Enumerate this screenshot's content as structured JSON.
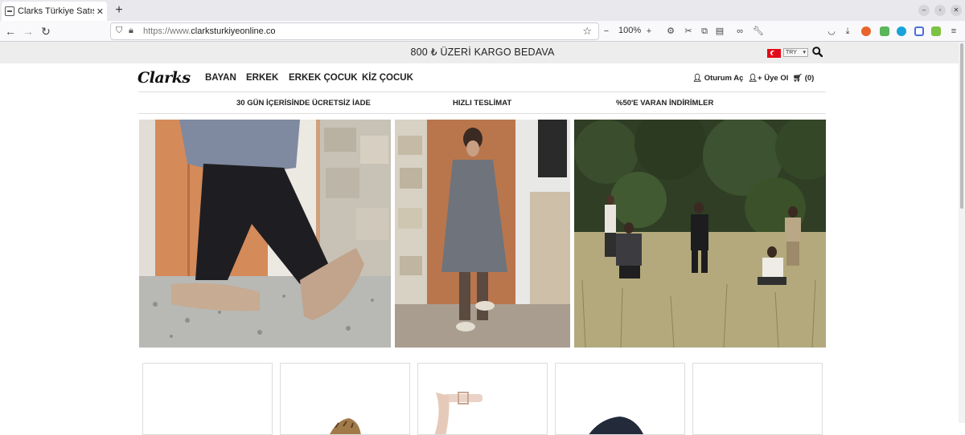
{
  "browser": {
    "tab_title": "Clarks Türkiye Satış Mağ",
    "new_tab_symbol": "+",
    "url_prefix": "https://www.",
    "url_domain": "clarksturkiyeonline.co",
    "zoom_level": "100%"
  },
  "site": {
    "announcement": "800 ₺ ÜZERİ KARGO BEDAVA",
    "currency_selected": "TRY",
    "logo_text": "Clarks",
    "nav": [
      "BAYAN",
      "ERKEK",
      "ERKEK ÇOCUK",
      "KİZ ÇOCUK"
    ],
    "account": {
      "login": "Oturum Aç",
      "register": "Üye Ol",
      "cart": "(0)"
    },
    "perks": [
      "30 GÜN İÇERİSİNDE ÜCRETSİZ İADE",
      "HIZLI TESLİMAT",
      "%50'E VARAN İNDİRİMLER"
    ],
    "colors": {
      "announce_bg": "#ededed",
      "flag_red": "#e30a17"
    }
  },
  "icons": {
    "search": "magnifier-icon",
    "user": "user-icon",
    "add_user": "user-plus-icon",
    "cart": "shopping-cart-icon"
  }
}
